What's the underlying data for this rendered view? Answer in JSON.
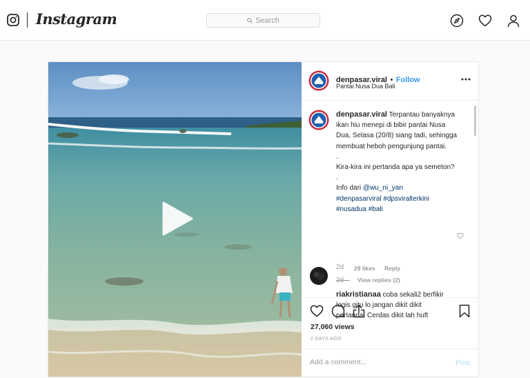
{
  "header": {
    "brand": "Instagram",
    "search_placeholder": "Search"
  },
  "icons": {
    "logo": "instagram-camera-icon",
    "explore": "compass-icon",
    "activity": "heart-icon",
    "profile": "person-icon",
    "play": "play-icon",
    "more": "more-options-icon",
    "like": "heart-icon",
    "comment": "comment-icon",
    "share": "share-icon",
    "save": "bookmark-icon"
  },
  "post": {
    "username": "denpasar.viral",
    "separator": "•",
    "follow_label": "Follow",
    "location": "Pantai Nusa Dua Bali",
    "caption": {
      "username": "denpasar.viral",
      "line1": "Terpantau banyaknya",
      "line2": "ikan hiu menepi di bibir pantai Nusa",
      "line3": "Dua, Selasa (20/8) siang tadi, sehingga",
      "line4": "membuat heboh pengunjung pantai.",
      "line5": ".",
      "line6": "Kira-kira ini pertanda apa ya semeton?",
      "line7": ".",
      "info_prefix": "Info dari",
      "mention": "@wu_ni_yan",
      "hashtag1": "#denpasarviral",
      "hashtag2": "#dpsviralterkini",
      "hashtag3": "#nusadua",
      "hashtag4": "#bali",
      "time": "2d"
    },
    "comment": {
      "username": "riakristianaa",
      "line1": "coba sekali2 berfikir",
      "line2": "logis gitu lo jangan dikit dikit",
      "line3": "pertanda. Cerdas dikit lah huft",
      "time": "2d",
      "likes": "29 likes",
      "reply_label": "Reply",
      "view_replies": "View replies (2)"
    },
    "views": "27,060 views",
    "posted_ago": "2 DAYS AGO",
    "add_comment_placeholder": "Add a comment...",
    "post_button": "Post"
  },
  "colors": {
    "link_blue": "#3897f0",
    "hashtag_blue": "#003569",
    "muted": "#999999",
    "post_disabled": "#b2dffc"
  }
}
